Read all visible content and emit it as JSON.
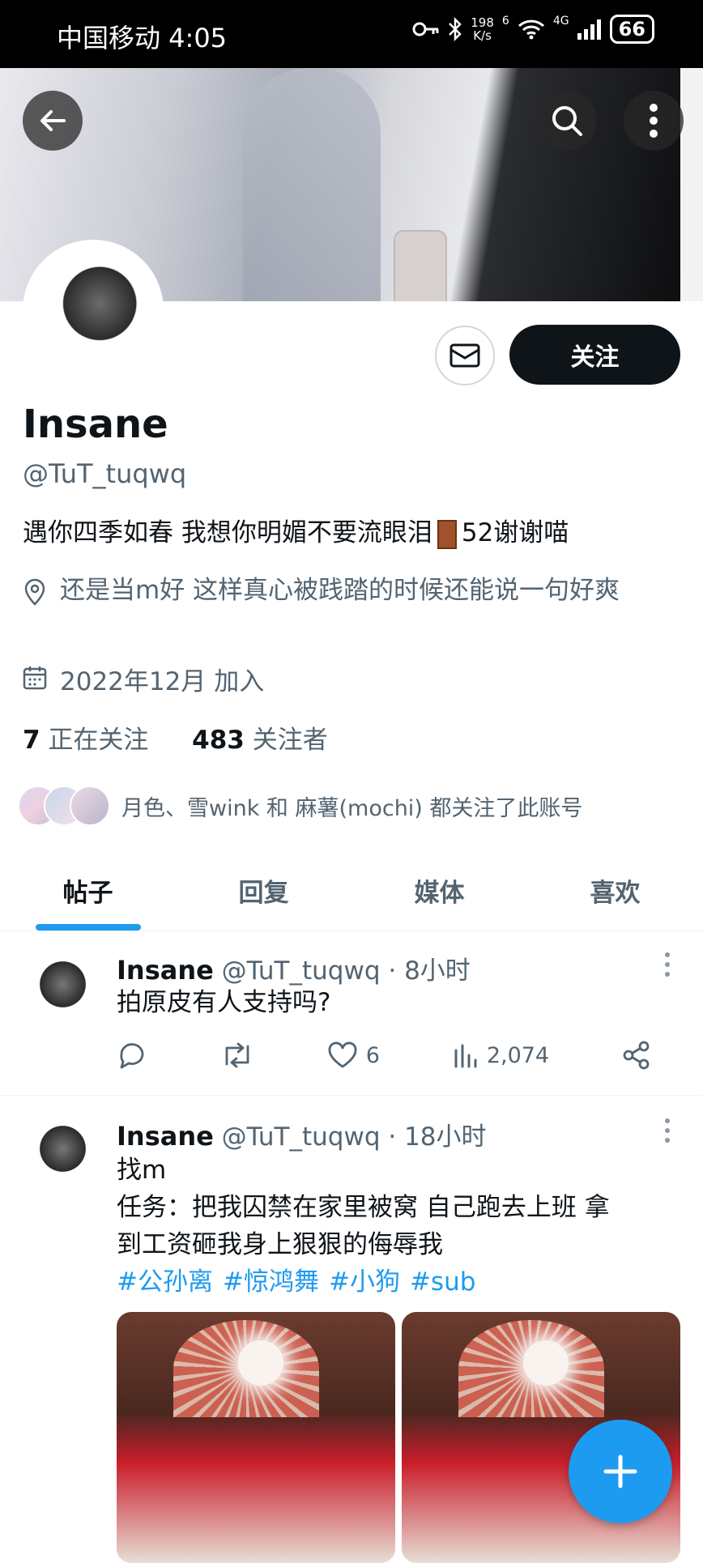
{
  "status_bar": {
    "carrier_time": "中国移动 4:05",
    "net_speed_value": "198",
    "net_speed_unit": "K/s",
    "network": "4G",
    "signal_prefix": "6",
    "battery": "66"
  },
  "profile": {
    "follow_label": "关注",
    "name": "Insane",
    "handle": "@TuT_tuqwq",
    "bio_part1": "遇你四季如春 我想你明媚不要流眼泪",
    "bio_part2": "52谢谢喵",
    "location": "还是当m好 这样真心被践踏的时候还能说一句好爽",
    "joined": "2022年12月 加入",
    "following_count": "7",
    "following_label": "正在关注",
    "followers_count": "483",
    "followers_label": "关注者",
    "followed_by": "月色、雪wink 和 麻薯(mochi) 都关注了此账号"
  },
  "tabs": [
    {
      "label": "帖子",
      "active": true
    },
    {
      "label": "回复",
      "active": false
    },
    {
      "label": "媒体",
      "active": false
    },
    {
      "label": "喜欢",
      "active": false
    }
  ],
  "posts": [
    {
      "name": "Insane",
      "handle": "@TuT_tuqwq",
      "time": "· 8小时",
      "text": "拍原皮有人支持吗?",
      "likes": "6",
      "views": "2,074"
    },
    {
      "name": "Insane",
      "handle": "@TuT_tuqwq",
      "time": "· 18小时",
      "line1": "找m",
      "line2": "任务：把我囚禁在家里被窝 自己跑去上班 拿",
      "line3": "到工资砸我身上狠狠的侮辱我",
      "hashtags": [
        "#公孙离",
        "#惊鸿舞",
        "#小狗",
        "#sub"
      ]
    }
  ],
  "colors": {
    "accent": "#1d9bf0",
    "text": "#0f1419",
    "secondary": "#536471"
  }
}
